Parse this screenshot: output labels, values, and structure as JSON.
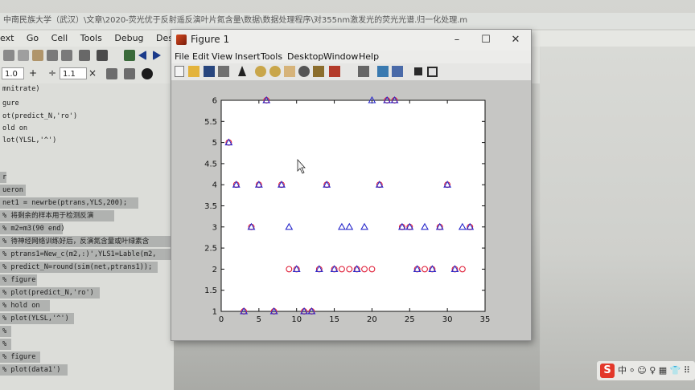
{
  "editor": {
    "title": "中南民族大学（武汉）\\文章\\2020-荧光优于反射遥反演叶片氮含量\\数据\\数据处理程序\\对355nm激发光的荧光光谱.归一化处理.m",
    "menu": [
      "ext",
      "Go",
      "Cell",
      "Tools",
      "Debug",
      "Desktop"
    ],
    "toolbar2": {
      "field1": "1.0",
      "plus": "+",
      "divide": "÷",
      "field2": "1.1",
      "times": "×"
    },
    "code_lines": [
      "mnitrate)",
      "gure",
      "ot(predict_N,'ro')",
      "old on",
      "lot(YLSL,'^')",
      "",
      "",
      "",
      "r",
      "ueron",
      "net1 = newrbe(ptrans,YLS,200);",
      "% 将剩余的样本用于检测反演",
      "% m2=m3(90 end)",
      "% 待神经网络训练好后，反演氮含量或叶绿素含",
      "% ptrans1=New_c(m2,:)',YLS1=Lable(m2,",
      "% predict_N=round(sim(net,ptrans1));",
      "% figure",
      "% plot(predict_N,'ro')",
      "% hold on",
      "% plot(YLSL,'^')",
      "%",
      "%",
      "% figure",
      "% plot(data1')"
    ]
  },
  "figure": {
    "title": "Figure 1",
    "menu": [
      "File",
      "Edit",
      "View",
      "Insert",
      "Tools",
      "Desktop",
      "Window",
      "Help"
    ],
    "window_buttons": {
      "minimize": "–",
      "maximize": "☐",
      "close": "✕"
    }
  },
  "chart_data": {
    "type": "scatter",
    "xlim": [
      0,
      35
    ],
    "ylim": [
      1,
      6
    ],
    "x_ticks": [
      0,
      5,
      10,
      15,
      20,
      25,
      30,
      35
    ],
    "y_ticks": [
      1,
      1.5,
      2,
      2.5,
      3,
      3.5,
      4,
      4.5,
      5,
      5.5,
      6
    ],
    "grid": false,
    "series": [
      {
        "marker": "circle",
        "color": "#e0203a",
        "x": [
          1,
          2,
          3,
          4,
          5,
          6,
          7,
          8,
          9,
          10,
          11,
          12,
          13,
          14,
          15,
          16,
          17,
          18,
          19,
          20,
          21,
          22,
          23,
          24,
          25,
          26,
          27,
          28,
          29,
          30,
          31,
          32,
          33
        ],
        "y": [
          5,
          4,
          1,
          3,
          4,
          6,
          1,
          4,
          2,
          2,
          1,
          1,
          2,
          4,
          2,
          2,
          2,
          2,
          2,
          2,
          4,
          6,
          6,
          3,
          3,
          2,
          2,
          2,
          3,
          4,
          2,
          2,
          3
        ]
      },
      {
        "marker": "triangle",
        "color": "#2a2acb",
        "x": [
          1,
          2,
          3,
          4,
          5,
          6,
          7,
          8,
          9,
          10,
          11,
          12,
          13,
          14,
          15,
          16,
          17,
          18,
          19,
          20,
          21,
          22,
          23,
          24,
          25,
          26,
          27,
          28,
          29,
          30,
          31,
          32,
          33
        ],
        "y": [
          5,
          4,
          1,
          3,
          4,
          6,
          1,
          4,
          3,
          2,
          1,
          1,
          2,
          4,
          2,
          3,
          3,
          2,
          3,
          6,
          4,
          6,
          6,
          3,
          3,
          2,
          3,
          2,
          3,
          4,
          2,
          3,
          3
        ]
      }
    ]
  },
  "tray": {
    "sogou": "S",
    "text": "中 ⸰ ☺ ♀ ▦ 👕 ⠿"
  },
  "colors": {
    "figure_bg": "#c6c6c4",
    "axes_bg": "#ffffff",
    "circle": "#e0203a",
    "triangle": "#2a2acb"
  }
}
